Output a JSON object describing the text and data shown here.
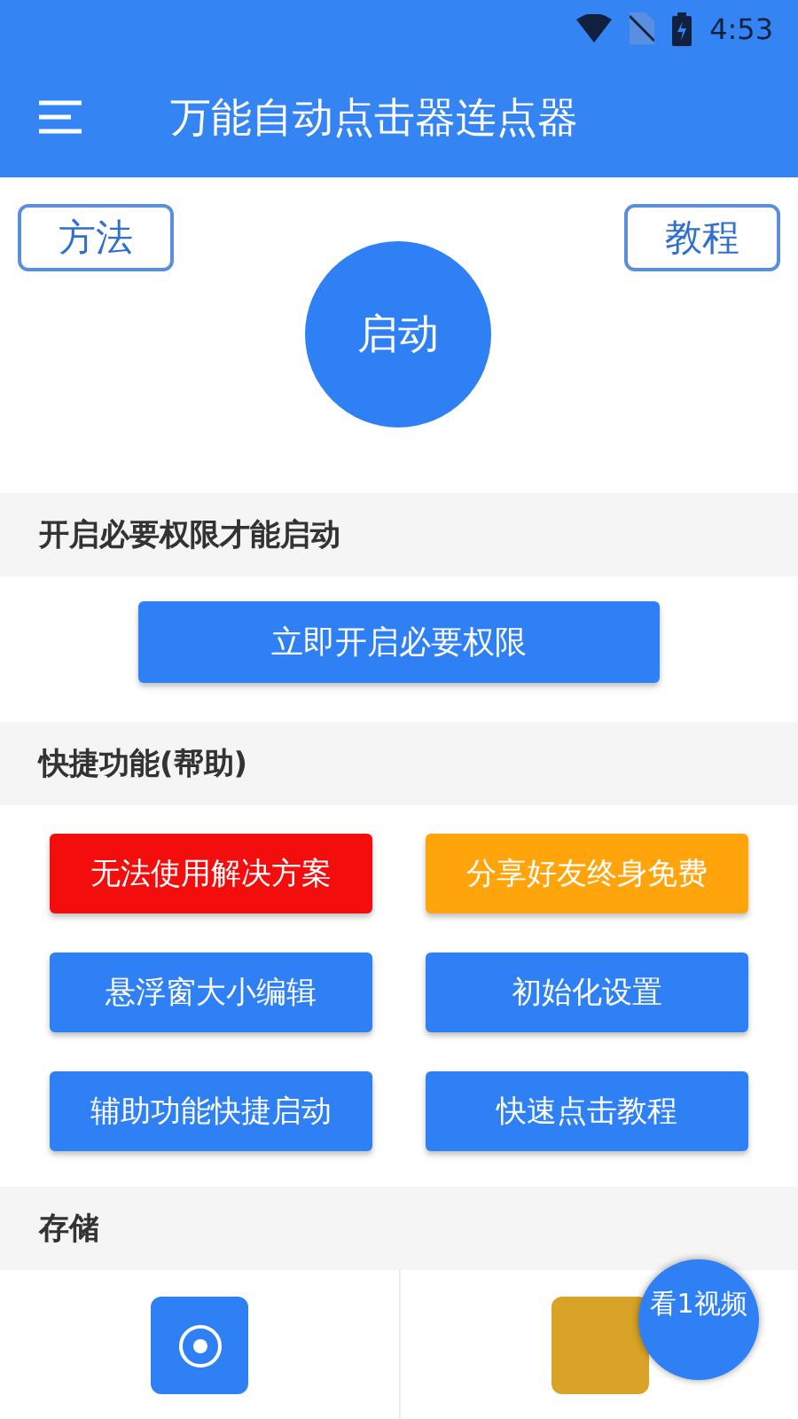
{
  "status_bar": {
    "time": "4:53"
  },
  "app_bar": {
    "title": "万能自动点击器连点器"
  },
  "top_buttons": [
    {
      "label": "方法"
    },
    {
      "label": "教程"
    }
  ],
  "start_button": {
    "label": "启动"
  },
  "permission_section": {
    "title": "开启必要权限才能启动",
    "button": "立即开启必要权限"
  },
  "shortcut_section": {
    "title": "快捷功能(帮助)",
    "buttons": [
      {
        "label": "无法使用解决方案",
        "color": "#f30d0d"
      },
      {
        "label": "分享好友终身免费",
        "color": "#ffa40a"
      },
      {
        "label": "悬浮窗大小编辑",
        "color": "#2f80f5"
      },
      {
        "label": "初始化设置",
        "color": "#2f80f5"
      },
      {
        "label": "辅助功能快捷启动",
        "color": "#2f80f5"
      },
      {
        "label": "快速点击教程",
        "color": "#2f80f5"
      }
    ]
  },
  "storage_section": {
    "title": "存储",
    "tiles": [
      {
        "color": "#2f80f5"
      },
      {
        "color": "#d9a327"
      }
    ]
  },
  "video_bubble": {
    "label": "看1视频"
  }
}
